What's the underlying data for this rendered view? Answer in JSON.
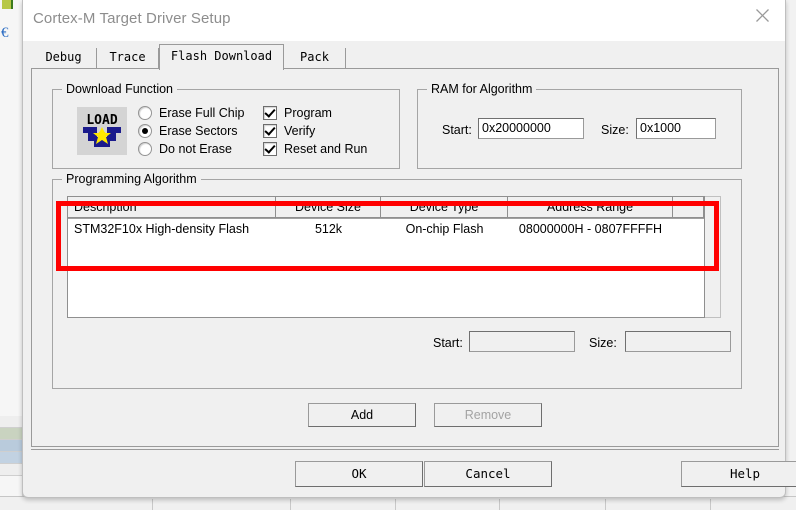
{
  "dialog": {
    "title": "Cortex-M Target Driver Setup",
    "close_icon": "close-icon"
  },
  "tabs": [
    {
      "label": "Debug",
      "active": false
    },
    {
      "label": "Trace",
      "active": false
    },
    {
      "label": "Flash Download",
      "active": true
    },
    {
      "label": "Pack",
      "active": false
    }
  ],
  "download_function": {
    "title": "Download Function",
    "icon_label": "LOAD",
    "radios": [
      {
        "label": "Erase Full Chip",
        "selected": false
      },
      {
        "label": "Erase Sectors",
        "selected": true
      },
      {
        "label": "Do not Erase",
        "selected": false
      }
    ],
    "checkboxes": [
      {
        "label": "Program",
        "checked": true
      },
      {
        "label": "Verify",
        "checked": true
      },
      {
        "label": "Reset and Run",
        "checked": true
      }
    ]
  },
  "ram_for_algorithm": {
    "title": "RAM for Algorithm",
    "start_label": "Start:",
    "start_value": "0x20000000",
    "size_label": "Size:",
    "size_value": "0x1000"
  },
  "programming_algorithm": {
    "title": "Programming Algorithm",
    "columns": [
      "Description",
      "Device Size",
      "Device Type",
      "Address Range"
    ],
    "rows": [
      {
        "description": "STM32F10x High-density Flash",
        "device_size": "512k",
        "device_type": "On-chip Flash",
        "address_range": "08000000H - 0807FFFFH"
      }
    ],
    "start_label": "Start:",
    "start_value": "",
    "size_label": "Size:",
    "size_value": "",
    "add_label": "Add",
    "remove_label": "Remove",
    "highlight_color": "#ff0000"
  },
  "footer": {
    "ok_label": "OK",
    "cancel_label": "Cancel",
    "help_label": "Help"
  }
}
